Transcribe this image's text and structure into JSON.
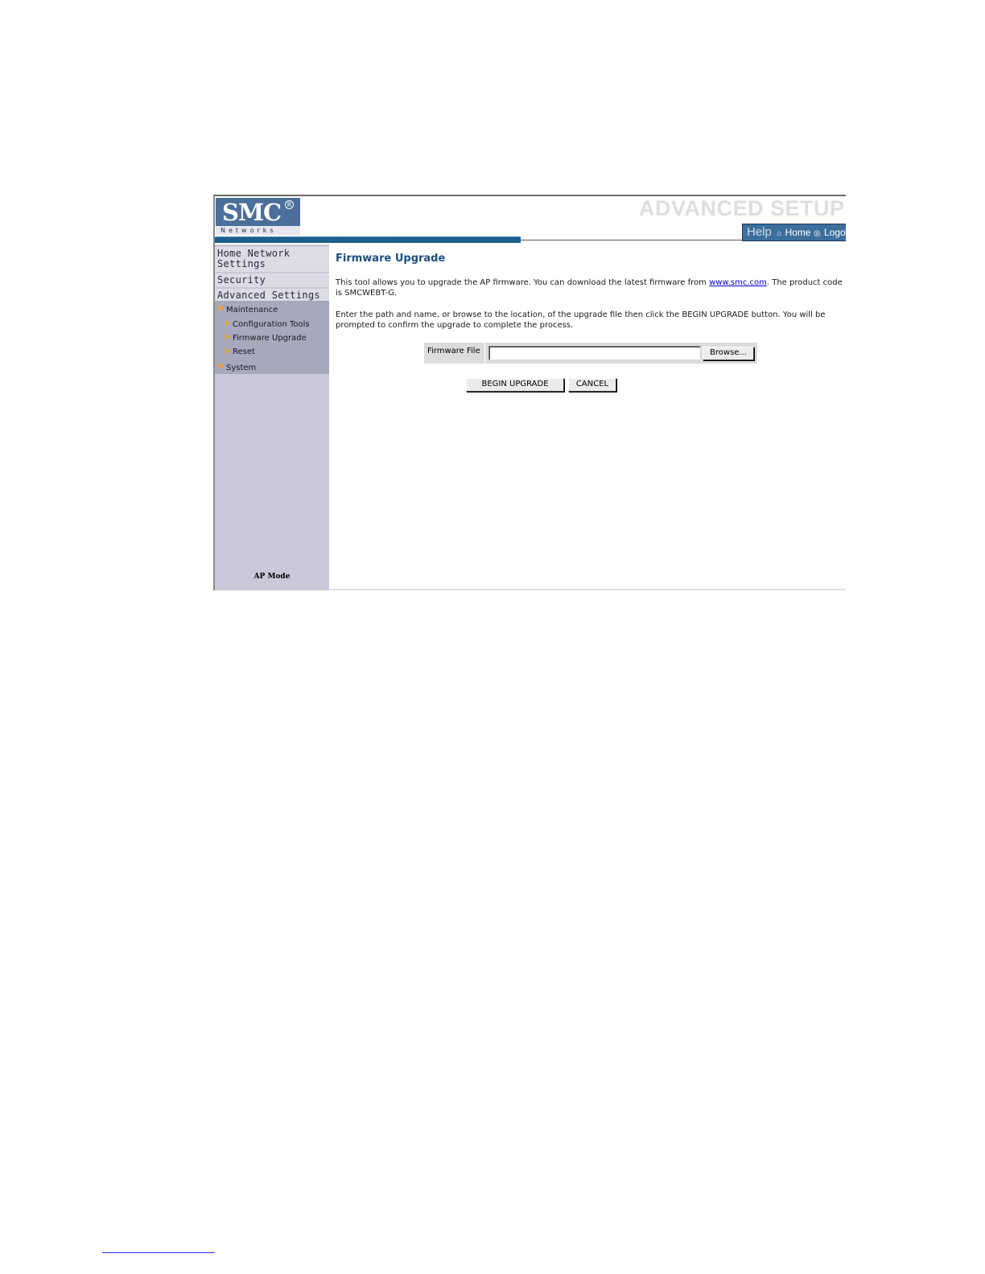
{
  "header": {
    "logo_brand": "SMC",
    "logo_reg": "R",
    "logo_sub": "Networks",
    "app_title": "ADVANCED SETUP",
    "links": {
      "help": "Help",
      "home": "Home",
      "logout": "Logout"
    }
  },
  "sidebar": {
    "items": [
      {
        "label": "Home Network Settings"
      },
      {
        "label": "Security"
      },
      {
        "label": "Advanced Settings"
      }
    ],
    "sections": [
      {
        "label": "Maintenance",
        "children": [
          "Configuration Tools",
          "Firmware Upgrade",
          "Reset"
        ]
      },
      {
        "label": "System"
      }
    ],
    "mode": "AP Mode"
  },
  "content": {
    "title": "Firmware Upgrade",
    "para1_pre": "This tool allows you to upgrade the AP firmware. You can download the latest firmware from ",
    "para1_link": "www.smc.com",
    "para1_post": ". The product code is SMCWEBT-G.",
    "para2": "Enter the path and name, or browse to the location, of the upgrade file then click the BEGIN UPGRADE button. You will be prompted to confirm the upgrade to complete the process.",
    "file_label": "Firmware File",
    "file_value": "",
    "browse_label": "Browse...",
    "begin_label": "BEGIN UPGRADE",
    "cancel_label": "CANCEL"
  },
  "colors": {
    "accent": "#1c5f8c",
    "title": "#1d4f7c",
    "sidebar": "#c8c8d8"
  }
}
